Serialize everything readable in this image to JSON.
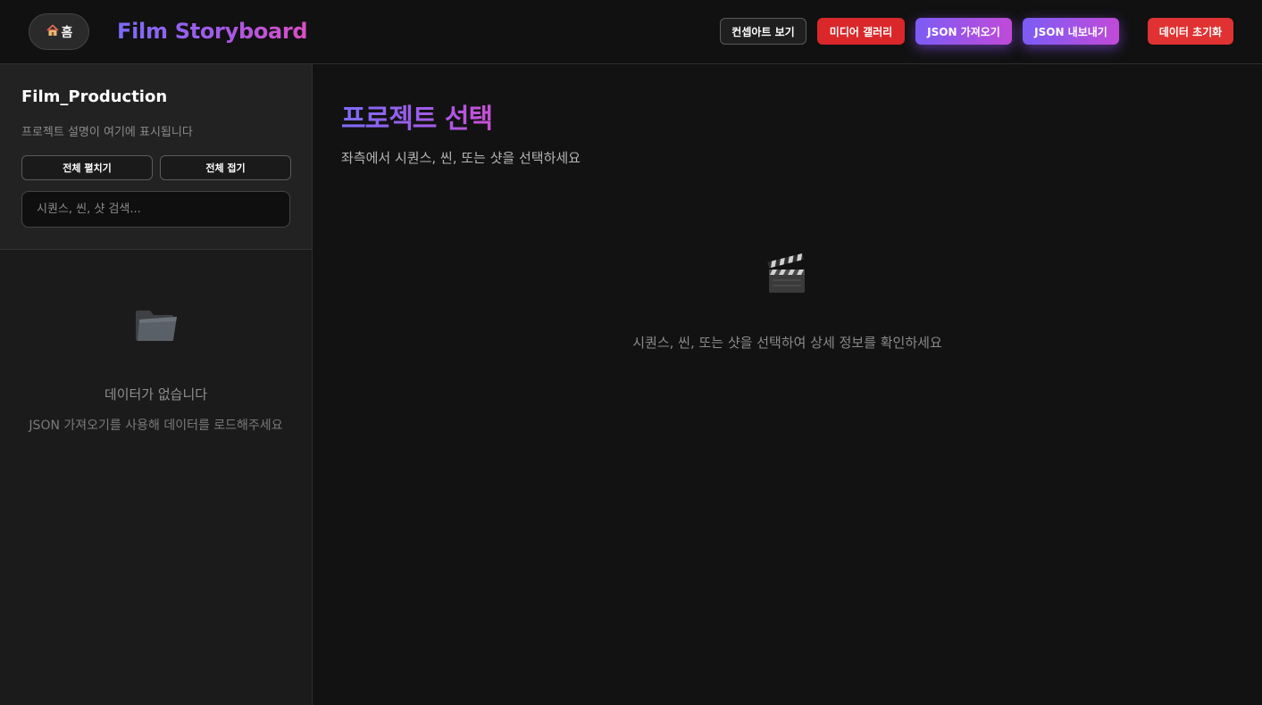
{
  "header": {
    "home_icon": "house-icon",
    "home_label": "홈",
    "app_title": "Film Storyboard",
    "buttons": {
      "concept_art": "컨셉아트 보기",
      "media_gallery": "미디어 갤러리",
      "json_import": "JSON 가져오기",
      "json_export": "JSON 내보내기",
      "reset_data": "데이터 초기화"
    }
  },
  "sidebar": {
    "project_name": "Film_Production",
    "project_desc": "프로젝트 설명이 여기에 표시됩니다",
    "expand_all": "전체 펼치기",
    "collapse_all": "전체 접기",
    "search_placeholder": "시퀀스, 씬, 샷 검색...",
    "empty_icon": "folder-icon",
    "empty_title": "데이터가 없습니다",
    "empty_sub": "JSON 가져오기를 사용해 데이터를 로드해주세요"
  },
  "main": {
    "title": "프로젝트 선택",
    "subtitle": "좌측에서 시퀀스, 씬, 또는 샷을 선택하세요",
    "placeholder_icon": "clapperboard-icon",
    "hint": "시퀀스, 씬, 또는 샷을 선택하여 상세 정보를 확인하세요"
  },
  "colors": {
    "accent_gradient_start": "#7b6cf6",
    "accent_gradient_end": "#d94fc3",
    "danger": "#e03232",
    "background": "#121212"
  }
}
